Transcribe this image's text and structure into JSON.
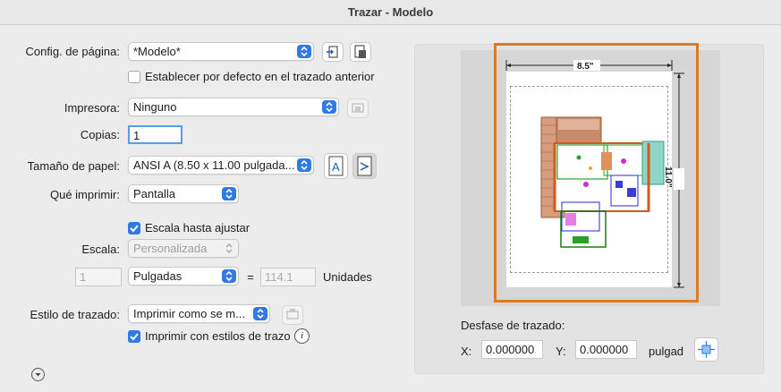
{
  "window": {
    "title": "Trazar - Modelo"
  },
  "page_setup": {
    "label": "Config. de página:",
    "value": "*Modelo*"
  },
  "set_default": {
    "label": "Establecer por defecto en el trazado anterior",
    "checked": false
  },
  "printer": {
    "label": "Impresora:",
    "value": "Ninguno"
  },
  "copies": {
    "label": "Copias:",
    "value": "1"
  },
  "paper_size": {
    "label": "Tamaño de papel:",
    "value": "ANSI A (8.50 x 11.00 pulgada..."
  },
  "what_to_print": {
    "label": "Qué imprimir:",
    "value": "Pantalla"
  },
  "fit_scale": {
    "label": "Escala hasta ajustar",
    "checked": true
  },
  "scale": {
    "label": "Escala:",
    "value": "Personalizada",
    "left_value": "1",
    "units_value": "Pulgadas",
    "equals": "=",
    "right_value": "114.1",
    "units_label": "Unidades"
  },
  "plot_style": {
    "label": "Estilo de trazado:",
    "value": "Imprimir como se m..."
  },
  "plot_with_styles": {
    "label": "Imprimir con estilos de trazo",
    "checked": true
  },
  "preview": {
    "width_label": "8.5\"",
    "height_label": "11.0\""
  },
  "offset": {
    "label": "Desfase de trazado:",
    "x_label": "X:",
    "x_value": "0.000000",
    "y_label": "Y:",
    "y_value": "0.000000",
    "units": "pulgad"
  },
  "colors": {
    "accent": "#2f7ae5",
    "highlight": "#e07a1e"
  }
}
